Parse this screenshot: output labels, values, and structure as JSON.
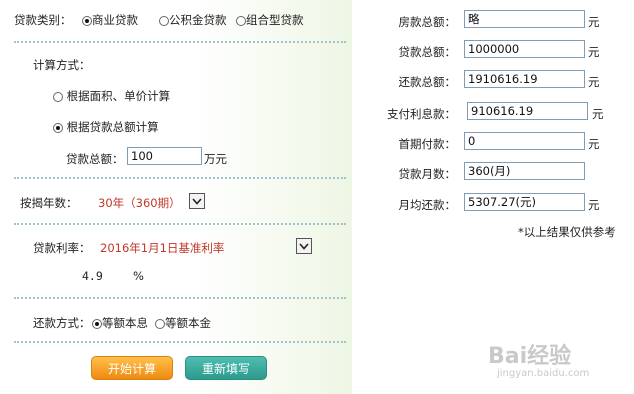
{
  "loan_type": {
    "label": "贷款类别：",
    "options": [
      "商业贷款",
      "公积金贷款",
      "组合型贷款"
    ],
    "selected": "商业贷款"
  },
  "calc_method": {
    "label": "计算方式：",
    "option_area": "根据面积、单价计算",
    "option_total": "根据贷款总额计算",
    "selected": "根据贷款总额计算"
  },
  "loan_total": {
    "label": "贷款总额：",
    "value": "100",
    "unit": "万元"
  },
  "years": {
    "label": "按揭年数：",
    "value": "30年（360期）"
  },
  "rate": {
    "label": "贷款利率：",
    "value": "2016年1月1日基准利率",
    "percent": "4.9",
    "percent_unit": "%"
  },
  "repay_method": {
    "label": "还款方式：",
    "options": [
      "等额本息",
      "等额本金"
    ],
    "selected": "等额本息"
  },
  "buttons": {
    "calculate": "开始计算",
    "reset": "重新填写"
  },
  "results": [
    {
      "label": "房款总额：",
      "value": "略",
      "unit": "元"
    },
    {
      "label": "贷款总额：",
      "value": "1000000",
      "unit": "元"
    },
    {
      "label": "还款总额：",
      "value": "1910616.19",
      "unit": "元"
    },
    {
      "label": "支付利息款：",
      "value": "910616.19",
      "unit": "元"
    },
    {
      "label": "首期付款：",
      "value": "0",
      "unit": "元"
    },
    {
      "label": "贷款月数：",
      "value": "360(月)",
      "unit": ""
    },
    {
      "label": "月均还款：",
      "value": "5307.27(元)",
      "unit": "元"
    }
  ],
  "note": "*以上结果仅供参考",
  "watermark": {
    "brand": "Bai经验",
    "url": "jingyan.baidu.com"
  }
}
